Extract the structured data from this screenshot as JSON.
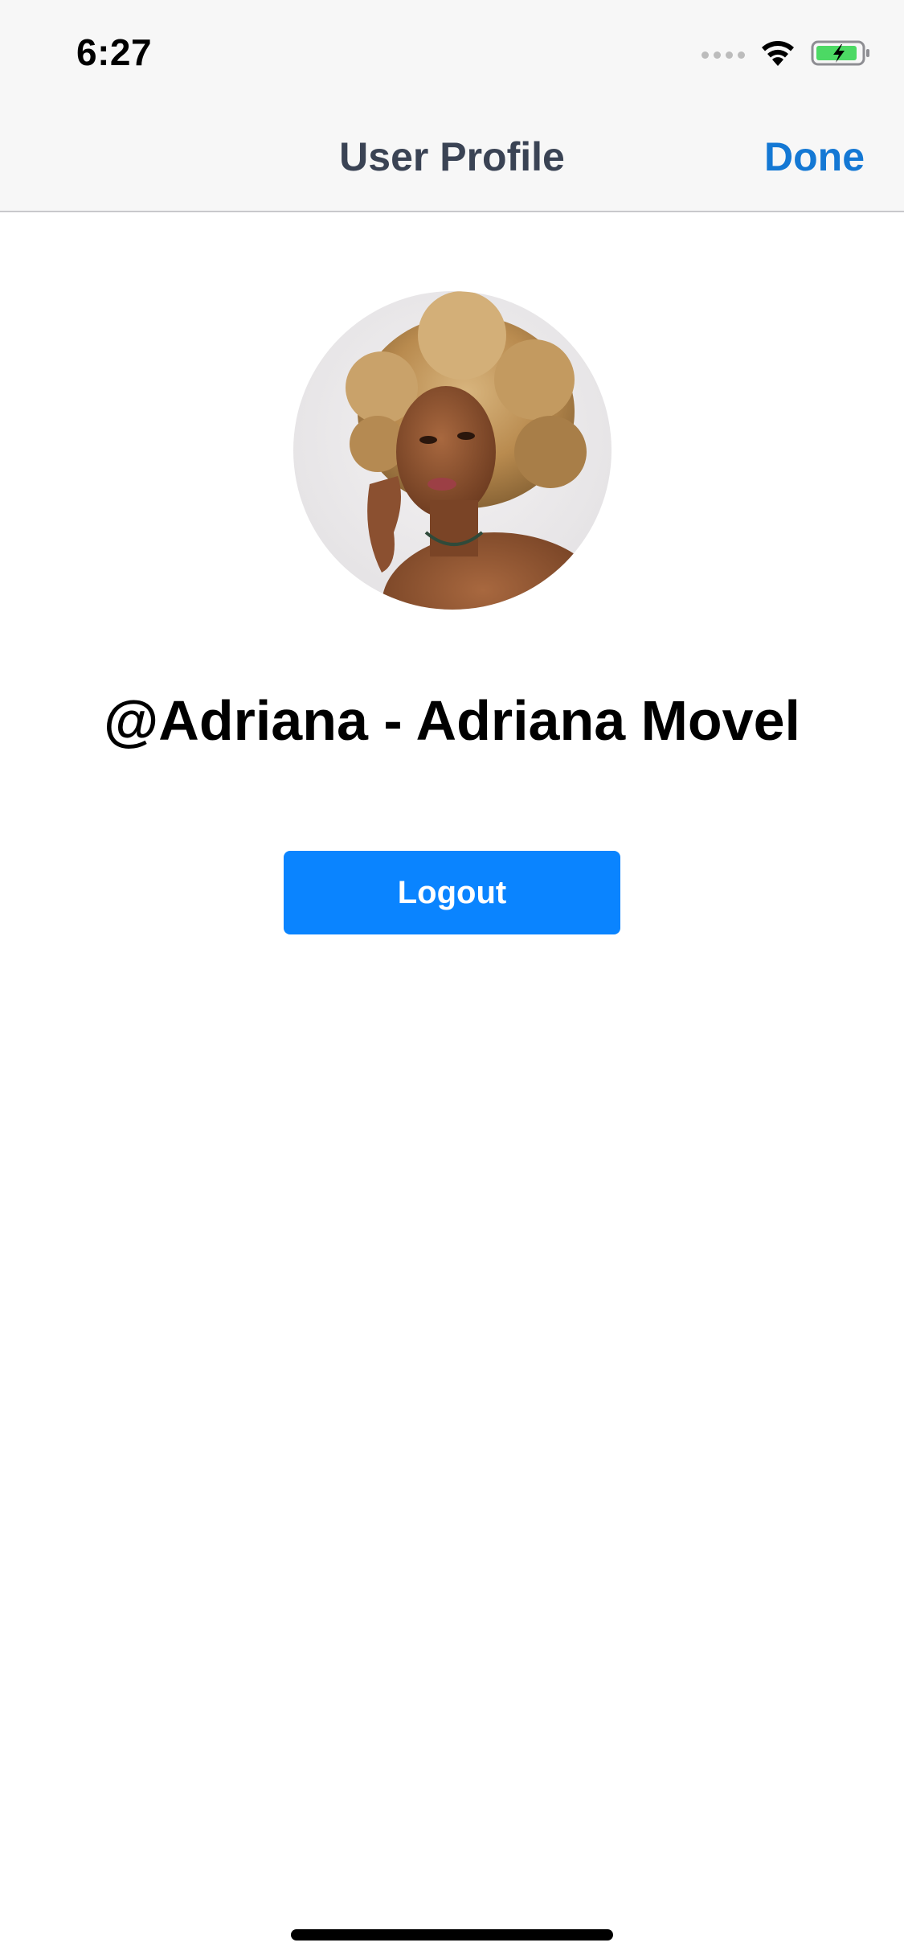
{
  "status_bar": {
    "time": "6:27",
    "signal_icon": "signal-dots-icon",
    "wifi_icon": "wifi-icon",
    "battery_icon": "battery-charging-icon",
    "battery_color": "#4cd964"
  },
  "nav_bar": {
    "title": "User Profile",
    "done_label": "Done",
    "accent_color": "#1478d4"
  },
  "profile": {
    "avatar_icon": "avatar-photo",
    "name": "@Adriana - Adriana Movel"
  },
  "actions": {
    "logout_label": "Logout",
    "button_color": "#0a84ff"
  }
}
